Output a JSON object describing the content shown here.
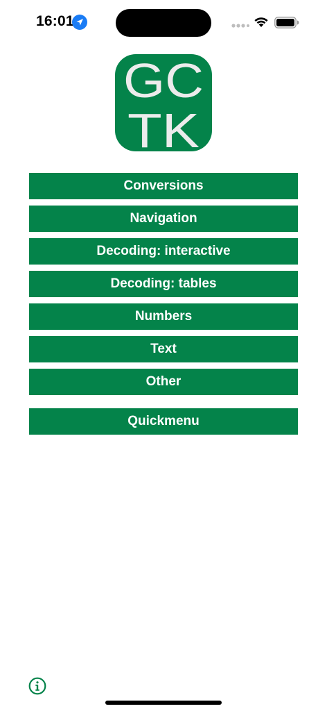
{
  "status_bar": {
    "time": "16:01",
    "icons": [
      "location-arrow-icon",
      "cellular-signal-icon",
      "wifi-icon",
      "battery-icon"
    ]
  },
  "logo": {
    "line1": "GC",
    "line2": "TK",
    "color": "#04834a"
  },
  "menu": {
    "items": [
      {
        "label": "Conversions"
      },
      {
        "label": "Navigation"
      },
      {
        "label": "Decoding: interactive"
      },
      {
        "label": "Decoding: tables"
      },
      {
        "label": "Numbers"
      },
      {
        "label": "Text"
      },
      {
        "label": "Other"
      }
    ],
    "quickmenu": {
      "label": "Quickmenu"
    }
  },
  "footer": {
    "info_icon": "info-circle-icon"
  },
  "colors": {
    "accent": "#04834a",
    "location_blue": "#1a7cf5",
    "background": "#ffffff"
  }
}
